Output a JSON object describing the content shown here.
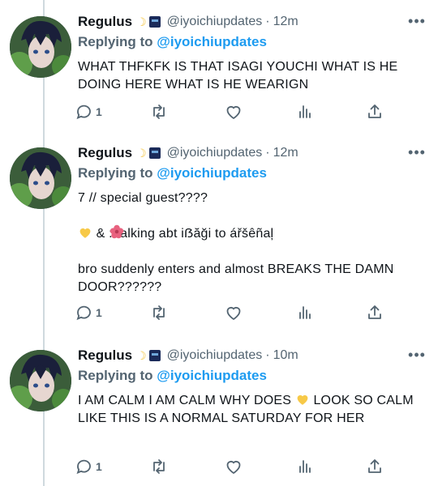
{
  "colors": {
    "mention": "#1d9bf0",
    "muted": "#536471",
    "text": "#0f1419"
  },
  "tweets": [
    {
      "display_name": "Regulus",
      "badges": [
        "crescent-moon-emoji",
        "flag-emoji"
      ],
      "handle": "@iyoichiupdates",
      "separator": "·",
      "time": "12m",
      "more": "•••",
      "replying_label": "Replying to",
      "replying_handle": "@iyoichiupdates",
      "paragraphs": [
        "WHAT THFKFK IS THAT ISAGI YOUCHI WHAT IS HE DOING HERE WHAT IS HE WEARIGN"
      ],
      "actions": {
        "reply_count": "1",
        "retweet_count": "",
        "like_count": ""
      }
    },
    {
      "display_name": "Regulus",
      "badges": [
        "crescent-moon-emoji",
        "flag-emoji"
      ],
      "handle": "@iyoichiupdates",
      "separator": "·",
      "time": "12m",
      "more": "•••",
      "replying_label": "Replying to",
      "replying_handle": "@iyoichiupdates",
      "paragraphs": [
        "7 // special guest????",
        "& : talking abt iẞăği to ářšêñaļ",
        "bro suddenly enters and almost BREAKS THE DAMN DOOR??????"
      ],
      "emojis": [
        "yellow-heart-emoji",
        "hibiscus-emoji"
      ],
      "actions": {
        "reply_count": "1",
        "retweet_count": "",
        "like_count": ""
      }
    },
    {
      "display_name": "Regulus",
      "badges": [
        "crescent-moon-emoji",
        "flag-emoji"
      ],
      "handle": "@iyoichiupdates",
      "separator": "·",
      "time": "10m",
      "more": "•••",
      "replying_label": "Replying to",
      "replying_handle": "@iyoichiupdates",
      "paragraphs": [
        "I AM CALM I AM CALM WHY DOES",
        "LOOK SO CALM LIKE THIS IS A NORMAL SATURDAY FOR HER"
      ],
      "emojis": [
        "yellow-heart-emoji"
      ],
      "actions": {
        "reply_count": "1",
        "retweet_count": "",
        "like_count": ""
      }
    }
  ]
}
